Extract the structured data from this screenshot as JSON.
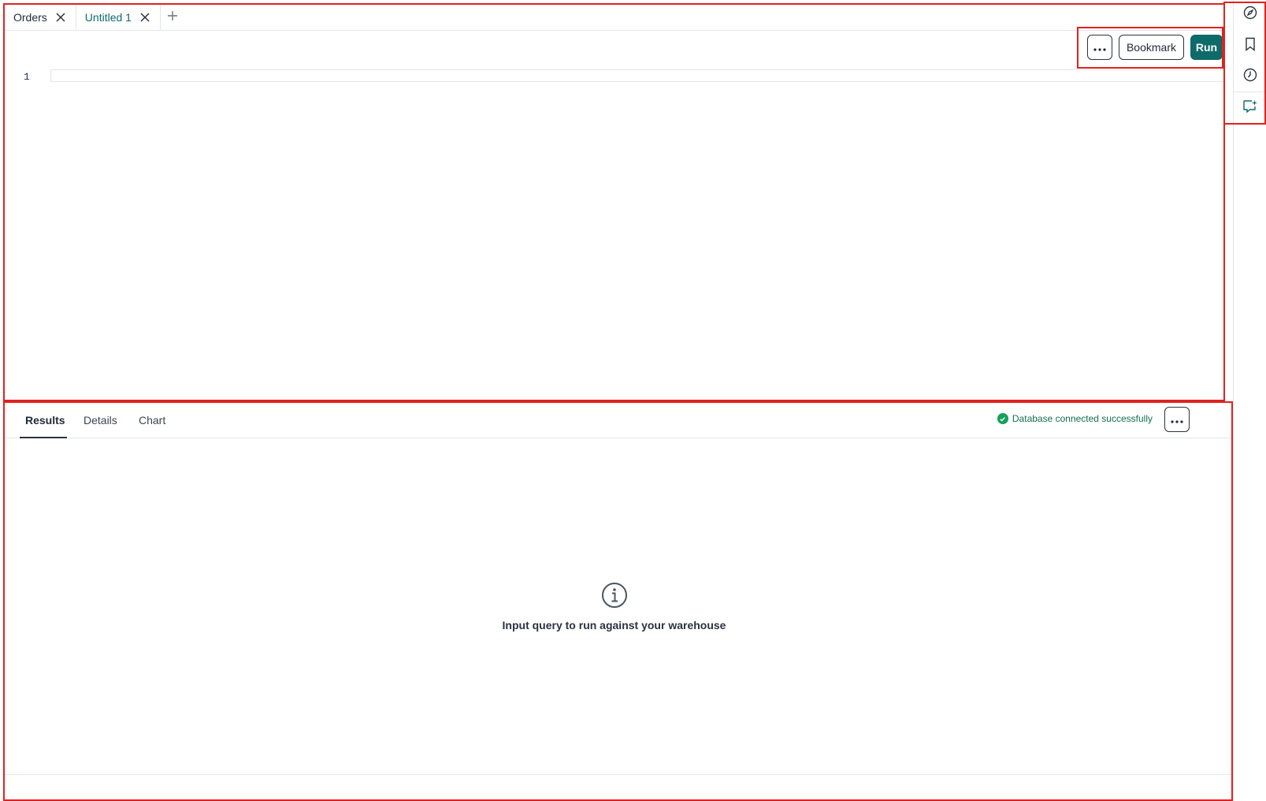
{
  "tabs": [
    {
      "label": "Orders",
      "close_icon": "close-icon"
    },
    {
      "label": "Untitled 1",
      "close_icon": "close-icon"
    }
  ],
  "add_tab_icon": "plus-icon",
  "toolbar": {
    "more_icon": "ellipsis-icon",
    "bookmark_label": "Bookmark",
    "run_label": "Run"
  },
  "editor": {
    "line_numbers": [
      "1"
    ],
    "content": ""
  },
  "results": {
    "tabs": [
      {
        "label": "Results",
        "selected": true
      },
      {
        "label": "Details",
        "selected": false
      },
      {
        "label": "Chart",
        "selected": false
      }
    ],
    "status_text": "Database connected successfully",
    "status_icon": "check-circle-icon",
    "empty_icon": "info-icon",
    "empty_message": "Input query to run against your warehouse"
  },
  "rail": {
    "items": [
      "compass-icon",
      "bookmark-icon",
      "history-icon",
      "ai-chat-icon"
    ]
  },
  "colors": {
    "accent": "#0f6a6a",
    "status_green": "#12a05a",
    "highlight_border": "#e0221f"
  }
}
